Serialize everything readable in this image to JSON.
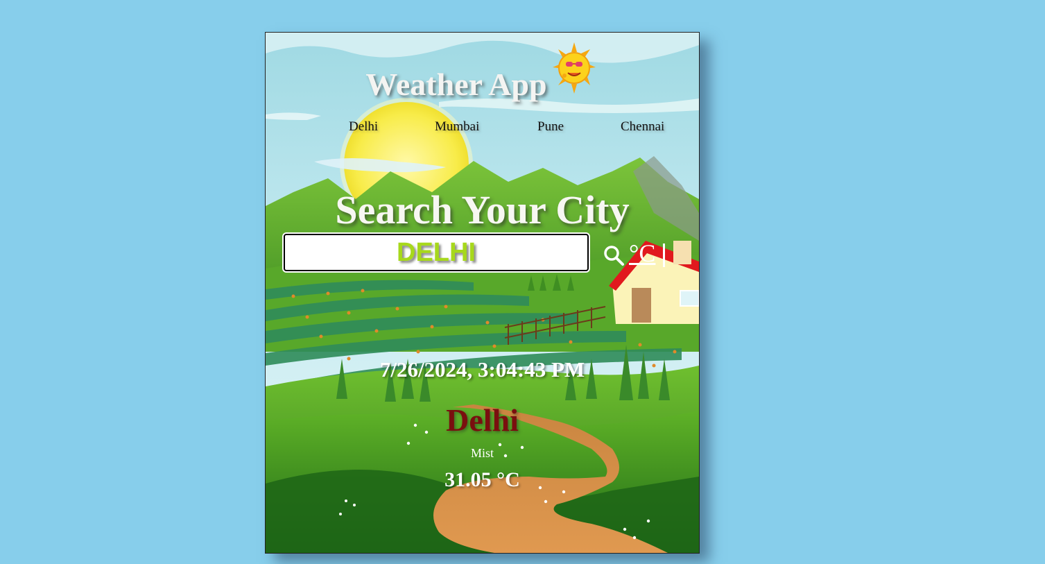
{
  "app": {
    "title": "Weather App",
    "logo_icon": "sun-mascot-icon"
  },
  "nav": {
    "items": [
      "Delhi",
      "Mumbai",
      "Pune",
      "Chennai"
    ]
  },
  "search": {
    "heading": "Search Your City",
    "value": "DELHI",
    "unit_toggle": "°C",
    "search_icon": "search-icon"
  },
  "weather": {
    "datetime": "7/26/2024, 3:04:43 PM",
    "city": "Delhi",
    "condition": "Mist",
    "temperature": "31.05 °C"
  },
  "colors": {
    "page_background": "#87ceeb",
    "search_text": "#a7d81c",
    "city_text": "#7a0f0f"
  }
}
